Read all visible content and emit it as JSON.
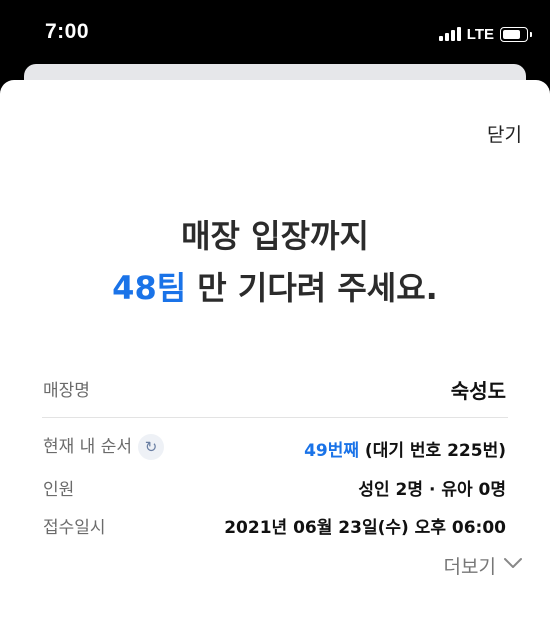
{
  "status": {
    "time": "7:00",
    "network": "LTE"
  },
  "sheet": {
    "close_label": "닫기",
    "headline_line1": "매장 입장까지",
    "headline_teams": "48팀",
    "headline_line2_rest": " 만 기다려 주세요."
  },
  "info": {
    "store": {
      "label": "매장명",
      "value": "숙성도"
    },
    "order": {
      "label": "현재 내 순서",
      "position": "49번째",
      "detail": " (대기 번호 225번)"
    },
    "party": {
      "label": "인원",
      "value": "성인 2명 · 유아 0명"
    },
    "time": {
      "label": "접수일시",
      "value": "2021년 06월 23일(수) 오후 06:00"
    },
    "more_label": "더보기"
  },
  "colors": {
    "accent": "#1a73e8",
    "text": "#2b2b2b",
    "label": "#6b6b6b"
  },
  "icons": {
    "refresh": "refresh-icon",
    "chevron": "chevron-down-icon",
    "signal": "signal-icon",
    "battery": "battery-icon"
  }
}
